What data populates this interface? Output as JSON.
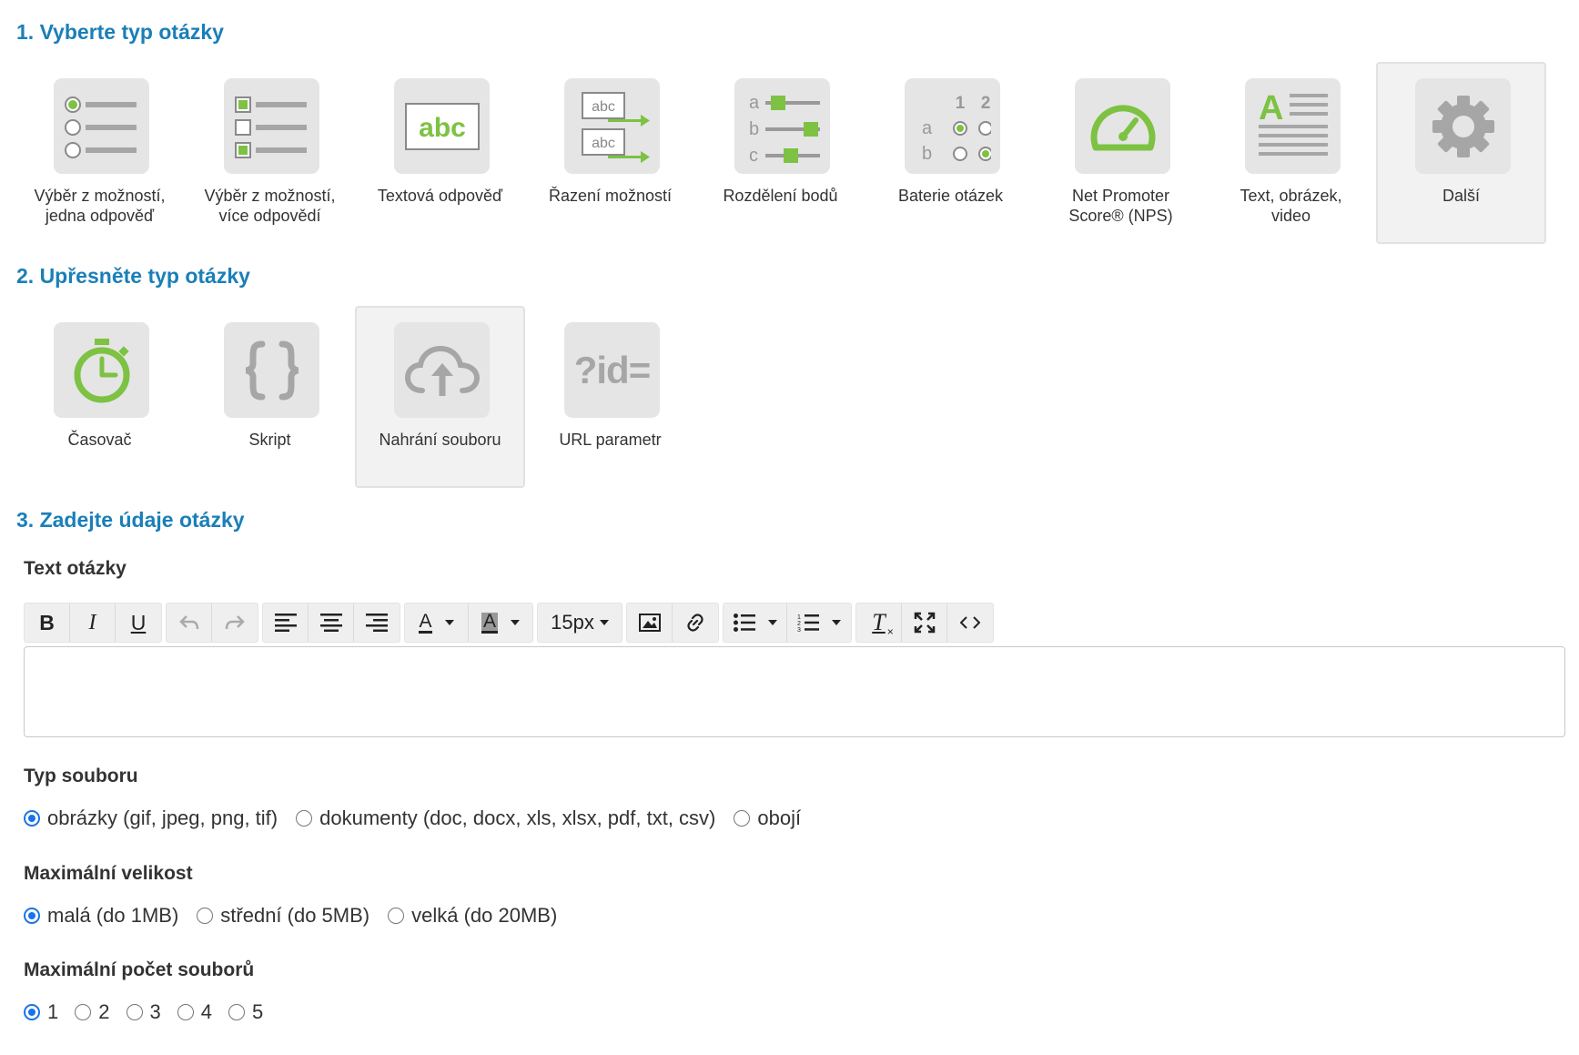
{
  "sections": {
    "step1": "1. Vyberte typ otázky",
    "step2": "2. Upřesněte typ otázky",
    "step3": "3. Zadejte údaje otázky"
  },
  "question_types": [
    {
      "label": "Výběr z možností,\njedna odpověď",
      "icon": "single-choice-icon"
    },
    {
      "label": "Výběr z možností,\nvíce odpovědí",
      "icon": "multiple-choice-icon"
    },
    {
      "label": "Textová odpověď",
      "icon": "text-answer-icon"
    },
    {
      "label": "Řazení možností",
      "icon": "ranking-icon"
    },
    {
      "label": "Rozdělení bodů",
      "icon": "points-distribution-icon"
    },
    {
      "label": "Baterie otázek",
      "icon": "question-battery-icon"
    },
    {
      "label": "Net Promoter\nScore® (NPS)",
      "icon": "nps-gauge-icon"
    },
    {
      "label": "Text, obrázek,\nvideo",
      "icon": "text-image-video-icon"
    },
    {
      "label": "Další",
      "icon": "gear-icon",
      "selected": true
    }
  ],
  "sub_types": [
    {
      "label": "Časovač",
      "icon": "stopwatch-icon"
    },
    {
      "label": "Skript",
      "icon": "script-braces-icon"
    },
    {
      "label": "Nahrání souboru",
      "icon": "cloud-upload-icon",
      "selected": true
    },
    {
      "label": "URL parametr",
      "icon": "url-parameter-icon",
      "icon_text": "?id="
    }
  ],
  "question_text": {
    "label": "Text otázky",
    "toolbar": {
      "font_size": "15px",
      "text_color_letter": "A",
      "bg_color_letter": "A",
      "icon_text_abc": "abc",
      "clear_letter": "T"
    }
  },
  "file_type": {
    "label": "Typ souboru",
    "options": [
      "obrázky (gif, jpeg, png, tif)",
      "dokumenty (doc, docx, xls, xlsx, pdf, txt, csv)",
      "obojí"
    ],
    "selected": 0
  },
  "max_size": {
    "label": "Maximální velikost",
    "options": [
      "malá (do 1MB)",
      "střední (do 5MB)",
      "velká (do 20MB)"
    ],
    "selected": 0
  },
  "max_count": {
    "label": "Maximální počet souborů",
    "options": [
      "1",
      "2",
      "3",
      "4",
      "5"
    ],
    "selected": 0
  },
  "colors": {
    "accent_green": "#7dc242",
    "title_blue": "#1a7fb8",
    "icon_gray": "#a6a6a6",
    "radio_blue": "#1a73e8"
  }
}
